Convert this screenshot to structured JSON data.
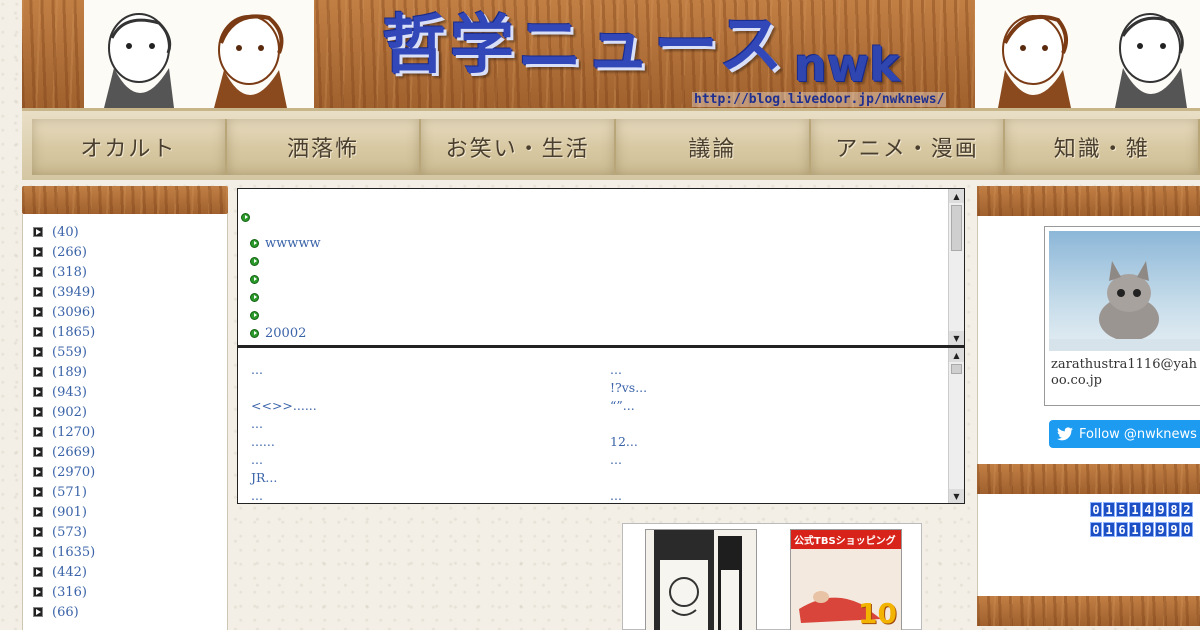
{
  "banner": {
    "title": "哲学ニュース",
    "subtitle": "nwk",
    "url": "http://blog.livedoor.jp/nwknews/"
  },
  "nav": [
    {
      "label": "オカルト"
    },
    {
      "label": "洒落怖"
    },
    {
      "label": "お笑い・生活"
    },
    {
      "label": "議論"
    },
    {
      "label": "アニメ・漫画"
    },
    {
      "label": "知識・雑"
    }
  ],
  "categories": [
    "(40)",
    "(266)",
    "(318)",
    "(3949)",
    "(3096)",
    "(1865)",
    "(559)",
    "(189)",
    "(943)",
    "(902)",
    "(1270)",
    "(2669)",
    "(2970)",
    "(571)",
    "(901)",
    "(573)",
    "(1635)",
    "(442)",
    "(316)",
    "(66)"
  ],
  "feed": {
    "items": [
      "",
      "wwwww",
      "",
      "",
      "",
      "",
      "20002"
    ]
  },
  "links": {
    "left": [
      "...",
      "",
      "<<>>......",
      "...",
      "......",
      "...",
      "JR...",
      "..."
    ],
    "right": [
      "...",
      " !?vs...",
      "“”...",
      "",
      "12...",
      "...",
      "",
      "..."
    ]
  },
  "ads": {
    "tbs_label": "公式TBSショッピング",
    "tbs_number": "10"
  },
  "profile": {
    "email": "zarathustra1116@yahoo.co.jp",
    "follow_label": "Follow @nwknews"
  },
  "counters": {
    "total": "01514982",
    "second": "01619990"
  },
  "colors": {
    "link": "#3a63a8",
    "wood": "#b2703a",
    "banner_blue": "#3348b8",
    "twitter": "#1d9bf0",
    "counter": "#1d4fc4"
  }
}
